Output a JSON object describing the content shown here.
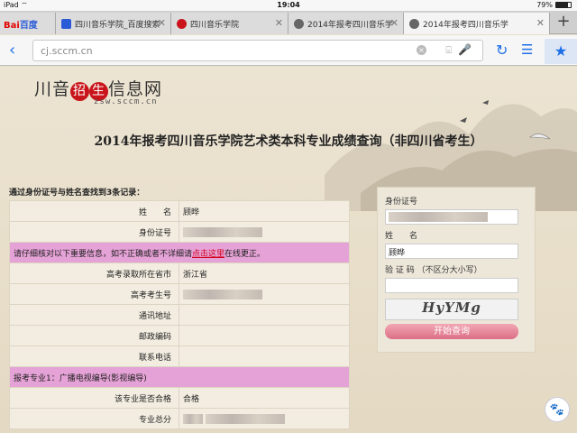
{
  "status": {
    "device": "iPad",
    "wifi": "⌔",
    "time": "19:04",
    "battery": "79%"
  },
  "tabs": [
    {
      "title": "",
      "fav": "#2a5bd7",
      "close": "✕"
    },
    {
      "title": "四川音乐学院_百度搜索",
      "fav": "#2a5bd7",
      "close": "✕"
    },
    {
      "title": "四川音乐学院",
      "fav": "#c8141a",
      "close": "✕"
    },
    {
      "title": "2014年报考四川音乐学",
      "fav": "#666666",
      "close": "✕"
    },
    {
      "title": "2014年报考四川音乐学",
      "fav": "#666666",
      "close": "✕"
    }
  ],
  "baidu_logo": {
    "bai": "Bai",
    "du": "百度"
  },
  "newtab_icon": "+",
  "address": {
    "url": "cj.sccm.cn",
    "clear_icon": "×",
    "camera_icon": "⌻",
    "mic_icon": "🎤",
    "back_icon": "‹",
    "refresh_icon": "↻",
    "menu_icon": "☰",
    "star_icon": "★"
  },
  "site": {
    "logo_a": "川音",
    "logo_b": "招",
    "logo_c": "生",
    "logo_d": "信息网",
    "logo_sub": "zsw.sccm.cn",
    "headline": "2014年报考四川音乐学院艺术类本科专业成绩查询（非四川省考生）",
    "count": "通过身份证号与姓名查找到3条记录："
  },
  "results": {
    "name_k": "姓　　名",
    "name_v": "顾晔",
    "id_k": "身份证号",
    "notice_a": "请仔细核对以下重要信息，如不正确或者不详细请",
    "notice_link": "点击这里",
    "notice_b": "在线更正。",
    "province_k": "高考录取所在省市",
    "province_v": "浙江省",
    "examno_k": "高考考生号",
    "addr_k": "通讯地址",
    "zip_k": "邮政编码",
    "phone_k": "联系电话",
    "major": "报考专业1：广播电视编导(影视编导)",
    "pass_k": "该专业是否合格",
    "pass_v": "合格",
    "total_k": "专业总分"
  },
  "panel": {
    "id_label": "身份证号",
    "name_label": "姓　　名",
    "name_value": "顾晔",
    "captcha_label": "验 证 码 （不区分大小写）",
    "captcha_text": "HyYMg",
    "submit": "开始查询"
  },
  "paw_icon": "🐾"
}
